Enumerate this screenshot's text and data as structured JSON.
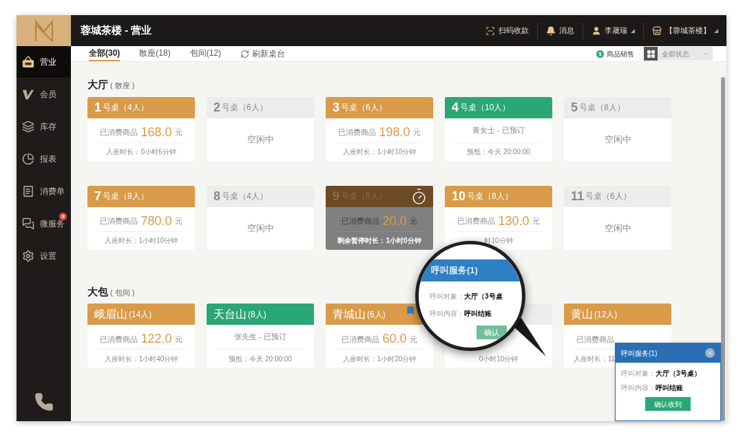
{
  "header": {
    "title": "蓉城茶楼 - 营业",
    "actions": [
      {
        "kind": "scan",
        "label": "扫码收款",
        "caret": false
      },
      {
        "kind": "bell",
        "label": "消息",
        "caret": false
      },
      {
        "kind": "user",
        "label": "李晟瑞",
        "caret": true
      },
      {
        "kind": "store",
        "label": "【蓉城茶楼】",
        "caret": true
      }
    ]
  },
  "sidebar": {
    "items": [
      {
        "kind": "shop",
        "label": "营业",
        "selected": true
      },
      {
        "kind": "vip",
        "label": "会员",
        "selected": false
      },
      {
        "kind": "layers",
        "label": "库存",
        "selected": false
      },
      {
        "kind": "pie",
        "label": "报表",
        "selected": false
      },
      {
        "kind": "bill",
        "label": "消费单",
        "selected": false
      },
      {
        "kind": "chat",
        "label": "微服务",
        "selected": false,
        "badge": "9"
      },
      {
        "kind": "gear",
        "label": "设置",
        "selected": false
      }
    ]
  },
  "tabs": [
    {
      "label": "全部(30)",
      "selected": true
    },
    {
      "label": "散座(18)",
      "selected": false
    },
    {
      "label": "包间(12)",
      "selected": false
    }
  ],
  "refresh": "刷新桌台",
  "goods_sales": "商品销售",
  "status_filter": "全部状态",
  "sections": [
    {
      "title": "大厅",
      "subtitle": "( 散座 )",
      "cards": [
        {
          "kind": "occupied",
          "name": "1",
          "capacity": "号桌（4人）",
          "spent_label": "已消费商品",
          "amount": "168.0",
          "unit": "元",
          "footer": "入座时长：0小时6分钟"
        },
        {
          "kind": "idle",
          "name": "2",
          "capacity": "号桌（6人）",
          "status": "空闲中"
        },
        {
          "kind": "occupied",
          "name": "3",
          "capacity": "号桌（6人）",
          "spent_label": "已消费商品",
          "amount": "198.0",
          "unit": "元",
          "footer": "入座时长：1小时10分钟"
        },
        {
          "kind": "reserved",
          "name": "4",
          "capacity": "号桌（10人）",
          "guest": "黄女士 - 已预订",
          "footer": "预抵：今天 20:00:00"
        },
        {
          "kind": "idle",
          "name": "5",
          "capacity": "号桌（8人）",
          "status": "空闲中"
        },
        {
          "kind": "occupied",
          "name": "7",
          "capacity": "号桌（8人）",
          "spent_label": "已消费商品",
          "amount": "780.0",
          "unit": "元",
          "footer": "入座时长：1小时10分钟"
        },
        {
          "kind": "idle",
          "name": "8",
          "capacity": "号桌（4人）",
          "status": "空闲中"
        },
        {
          "kind": "paused",
          "name": "9",
          "capacity": "号桌（5人）",
          "spent_label": "已消费商品",
          "amount": "20.0",
          "unit": "元",
          "footer": "剩余暂停时长：1小时0分钟"
        },
        {
          "kind": "occupied",
          "name": "10",
          "capacity": "号桌（8人）",
          "spent_label": "已消费商品",
          "amount": "130.0",
          "unit": "元",
          "footer": "时10分钟"
        },
        {
          "kind": "idle",
          "name": "11",
          "capacity": "号桌（6人）",
          "status": "空闲中"
        }
      ]
    },
    {
      "title": "大包",
      "subtitle": "( 包间 )",
      "cards": [
        {
          "kind": "occupied",
          "name": "峨眉山",
          "capacity": "(14人)",
          "spent_label": "已消费商品",
          "amount": "122.0",
          "unit": "元",
          "footer": "入座时长：1小时40分钟"
        },
        {
          "kind": "reserved",
          "name": "天台山",
          "capacity": "(8人)",
          "guest": "张先生 - 已预订",
          "footer": "预抵：今天 20:00:00"
        },
        {
          "kind": "occupied",
          "name": "青城山",
          "capacity": "(6人)",
          "spent_label": "已消费商品",
          "amount": "60.0",
          "unit": "元",
          "footer": "入座时长：1小时20分钟",
          "ribbon": true
        },
        {
          "kind": "covered",
          "footer": "0小时10分钟"
        },
        {
          "kind": "occupied",
          "name": "黄山",
          "capacity": "(12人)",
          "spent_label": "已消费商品",
          "footer": "入座时长：11",
          "cut": true
        }
      ]
    }
  ],
  "magnifier": {
    "title": "呼叫服务(1)",
    "target_label": "呼叫对象：",
    "target": "大厅（3号桌",
    "content_label": "呼叫内容：",
    "content": "呼叫结账",
    "button": "确认"
  },
  "popup": {
    "title": "呼叫服务(1)",
    "target_label": "呼叫对象：",
    "target": "大厅（3号桌）",
    "content_label": "呼叫内容：",
    "content": "呼叫结账",
    "button": "确认收到"
  }
}
